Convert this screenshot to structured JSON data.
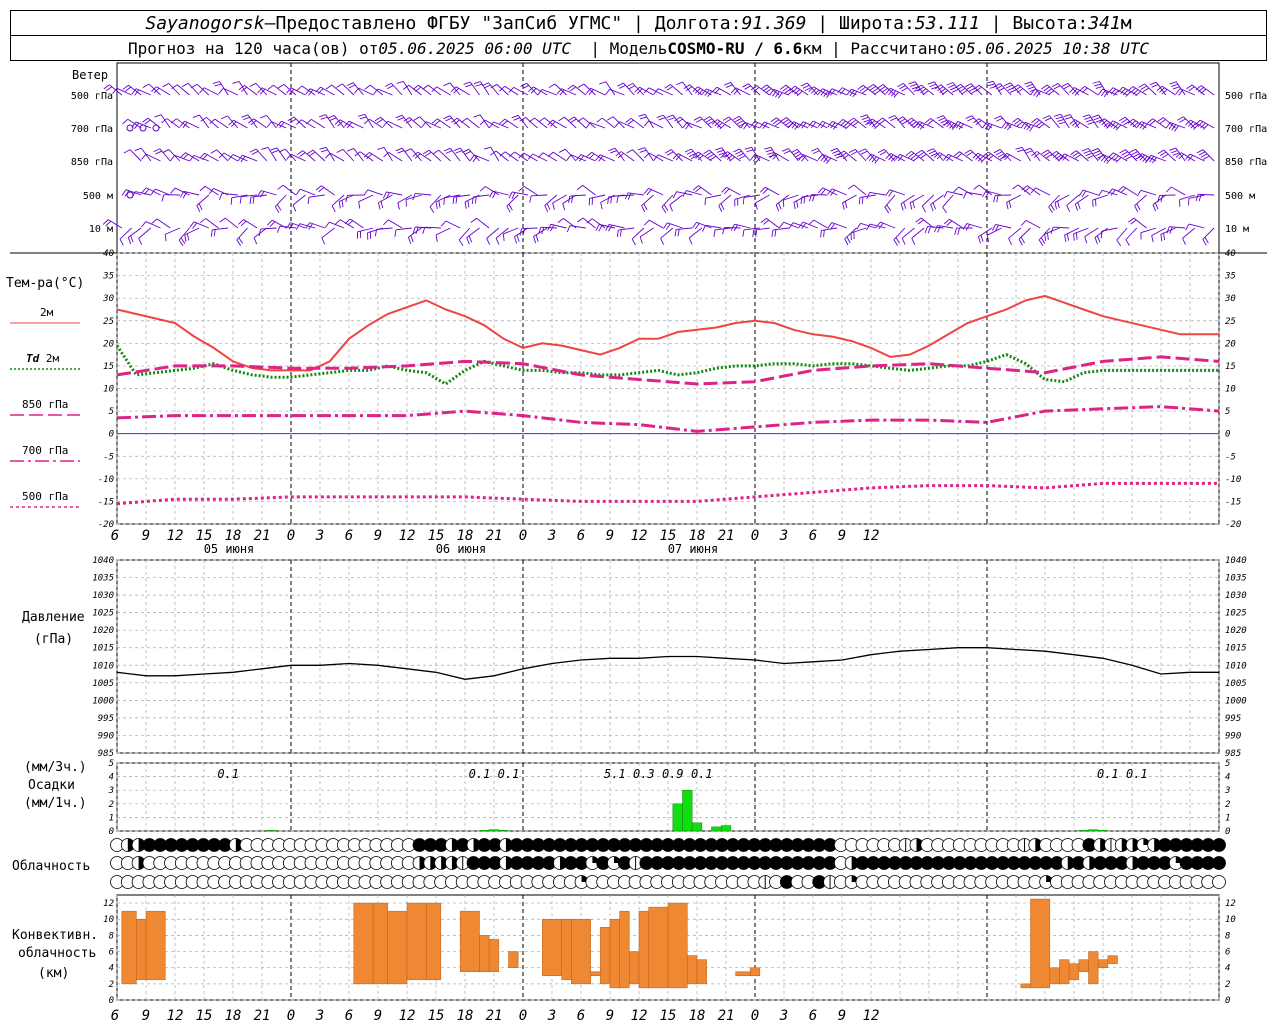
{
  "header": {
    "station": "Sayanogorsk",
    "dash": "—",
    "provided": "Предоставлено ФГБУ \"ЗапСиб УГМС\"",
    "lon_label": "Долгота:",
    "lon": "91.369",
    "lat_label": "Широта:",
    "lat": "53.111",
    "alt_label": "Высота:",
    "alt": "341",
    "alt_unit": "м",
    "forecast_label": "Прогноз на 120 часа(ов) от",
    "forecast_time": "05.06.2025 06:00 UTC",
    "model_label": "Модель",
    "model": "COSMO-RU / 6.6",
    "model_unit": "км",
    "computed_label": "Рассчитано:",
    "computed_time": "05.06.2025 10:38 UTC"
  },
  "colors": {
    "t2m": "#ee4444",
    "td2m": "#118811",
    "t850": "#dd2288",
    "t700": "#dd2288",
    "t500": "#dd2288",
    "zero": "#3333ee",
    "wind": "#6600cc",
    "precip": "#11dd11",
    "convective": "#ee8833",
    "pressure": "#000000",
    "grid": "#aaaaaa"
  },
  "labels": {
    "wind": "Ветер",
    "wind_levels": [
      "500 гПа",
      "700 гПа",
      "850 гПа",
      "500 м",
      "10 м"
    ],
    "temperature": "Тем-ра(°C)",
    "t2m": "2м",
    "td_symbol": "Td",
    "td2m": "2м",
    "t850": "850 гПа",
    "t700": "700 гПа",
    "t500": "500 гПа",
    "pressure": "Давление",
    "pressure_unit": "(гПа)",
    "precip_unit_top": "(мм/3ч.)",
    "precip": "Осадки",
    "precip_unit_bottom": "(мм/1ч.)",
    "clouds": "Облачность",
    "convective_1": "Конвективн.",
    "convective_2": "облачность",
    "convective_3": "(км)"
  },
  "time_axis": {
    "ticks": [
      "6",
      "9",
      "12",
      "15",
      "18",
      "21",
      "0",
      "3",
      "6",
      "9",
      "12",
      "15",
      "18",
      "21",
      "0",
      "3",
      "6",
      "9",
      "12",
      "15",
      "18",
      "21",
      "0",
      "3",
      "6",
      "9",
      "12"
    ],
    "dates": [
      "05 июня",
      "06 июня",
      "07 июня"
    ]
  },
  "chart_data": [
    {
      "type": "line",
      "name": "temperature",
      "x_unit": "hours since 05.06.2025 06:00 UTC",
      "ylim": [
        -20,
        40
      ],
      "yticks": [
        -20,
        -15,
        -10,
        -5,
        0,
        5,
        10,
        15,
        20,
        25,
        30,
        35,
        40
      ],
      "series": [
        {
          "name": "2м",
          "style": "solid",
          "x": [
            0,
            2,
            4,
            6,
            8,
            10,
            12,
            14,
            16,
            18,
            20,
            22,
            24,
            26,
            28,
            30,
            32,
            34,
            36,
            38,
            40,
            42,
            44,
            46,
            48,
            50,
            52,
            54,
            56,
            58,
            60,
            62,
            64,
            66,
            68,
            70,
            72,
            74,
            76,
            78,
            80,
            82,
            84,
            86,
            88,
            90,
            92,
            94,
            96,
            98,
            100,
            102,
            104,
            106,
            108,
            110,
            112,
            114
          ],
          "y": [
            27.5,
            26.5,
            25.5,
            24.5,
            21.5,
            19,
            16,
            14.5,
            14,
            14,
            14,
            16,
            21,
            24,
            26.5,
            28,
            29.5,
            27.5,
            26,
            24,
            21,
            19,
            20,
            19.5,
            18.5,
            17.5,
            19,
            21,
            21,
            22.5,
            23,
            23.5,
            24.5,
            25,
            24.5,
            23,
            22,
            21.5,
            20.5,
            19,
            17,
            17.5,
            19.5,
            22,
            24.5,
            26,
            27.5,
            29.5,
            30.5,
            29,
            27.5,
            26,
            25,
            24,
            23,
            22,
            22,
            22
          ]
        },
        {
          "name": "Td 2м",
          "style": "dotted",
          "x": [
            0,
            2,
            4,
            6,
            8,
            10,
            12,
            14,
            16,
            18,
            20,
            22,
            24,
            26,
            28,
            30,
            32,
            34,
            36,
            38,
            40,
            42,
            44,
            46,
            48,
            50,
            52,
            54,
            56,
            58,
            60,
            62,
            64,
            66,
            68,
            70,
            72,
            74,
            76,
            78,
            80,
            82,
            84,
            86,
            88,
            90,
            92,
            94,
            96,
            98,
            100,
            102,
            104,
            106,
            108,
            110,
            112,
            114
          ],
          "y": [
            19.5,
            13,
            13.5,
            14,
            14.5,
            15.5,
            14,
            13,
            12.5,
            12.5,
            13,
            13.5,
            14,
            14,
            15,
            14,
            13.5,
            11,
            14,
            16,
            15,
            14,
            14,
            13.5,
            13.5,
            13,
            13,
            13.5,
            14,
            13,
            13.5,
            14.5,
            15,
            15,
            15.5,
            15.5,
            15,
            15.5,
            15.5,
            15,
            14.5,
            14,
            14.5,
            15,
            15,
            16,
            17.5,
            15.5,
            12,
            11.5,
            13.5,
            14,
            14,
            14,
            14,
            14,
            14,
            14
          ]
        },
        {
          "name": "850 гПа",
          "style": "longdash",
          "x": [
            0,
            6,
            12,
            18,
            24,
            30,
            36,
            42,
            48,
            54,
            60,
            66,
            72,
            78,
            84,
            90,
            96,
            102,
            108,
            114
          ],
          "y": [
            13,
            15,
            15,
            14.5,
            14.5,
            15,
            16,
            15.5,
            13,
            12,
            11,
            11.5,
            14,
            15,
            15.5,
            14.5,
            13.5,
            16,
            17,
            16
          ]
        },
        {
          "name": "700 гПа",
          "style": "dashdot",
          "x": [
            0,
            6,
            12,
            18,
            24,
            30,
            36,
            42,
            48,
            54,
            60,
            66,
            72,
            78,
            84,
            90,
            96,
            102,
            108,
            114
          ],
          "y": [
            3.5,
            4,
            4,
            4,
            4,
            4,
            5,
            4,
            2.5,
            2,
            0.5,
            1.5,
            2.5,
            3,
            3,
            2.5,
            5,
            5.5,
            6,
            5
          ]
        },
        {
          "name": "500 гПа",
          "style": "shortdash",
          "x": [
            0,
            6,
            12,
            18,
            24,
            30,
            36,
            42,
            48,
            54,
            60,
            66,
            72,
            78,
            84,
            90,
            96,
            102,
            108,
            114
          ],
          "y": [
            -15.5,
            -14.5,
            -14.5,
            -14,
            -14,
            -14,
            -14,
            -14.5,
            -15,
            -15,
            -15,
            -14,
            -13,
            -12,
            -11.5,
            -11.5,
            -12,
            -11,
            -11,
            -11
          ]
        }
      ]
    },
    {
      "type": "line",
      "name": "pressure",
      "x_unit": "hours since 05.06.2025 06:00 UTC",
      "ylim": [
        985,
        1040
      ],
      "yticks": [
        985,
        990,
        995,
        1000,
        1005,
        1010,
        1015,
        1020,
        1025,
        1030,
        1035,
        1040
      ],
      "series": [
        {
          "name": "Давление",
          "style": "solid",
          "x": [
            0,
            3,
            6,
            9,
            12,
            15,
            18,
            21,
            24,
            27,
            30,
            33,
            36,
            39,
            42,
            45,
            48,
            51,
            54,
            57,
            60,
            63,
            66,
            69,
            72,
            75,
            78,
            81,
            84,
            87,
            90,
            93,
            96,
            99,
            102,
            105,
            108,
            111,
            114
          ],
          "y": [
            1008,
            1007,
            1007,
            1007.5,
            1008,
            1009,
            1010,
            1010,
            1010.5,
            1010,
            1009,
            1008,
            1006,
            1007,
            1009,
            1010.5,
            1011.5,
            1012,
            1012,
            1012.5,
            1012.5,
            1012,
            1011.5,
            1010.5,
            1011,
            1011.5,
            1013,
            1014,
            1014.5,
            1015,
            1015,
            1014.5,
            1014,
            1013,
            1012,
            1010,
            1007.5,
            1008,
            1008
          ]
        }
      ]
    },
    {
      "type": "bar",
      "name": "precipitation",
      "x_unit": "hours since 05.06.2025 06:00 UTC",
      "ylim": [
        0,
        5
      ],
      "yticks": [
        0,
        1,
        2,
        3,
        4,
        5
      ],
      "values_x": [
        16,
        17,
        18,
        36,
        37,
        38,
        39,
        40,
        41,
        42,
        52,
        53,
        54,
        55,
        56,
        57,
        58,
        59,
        60,
        61,
        62,
        63,
        100,
        101,
        102
      ],
      "values": [
        0.05,
        0,
        0,
        0,
        0,
        0.05,
        0.1,
        0.05,
        0,
        0,
        0,
        0,
        0,
        0,
        0,
        0,
        2,
        3,
        0.6,
        0,
        0.3,
        0.4,
        0.05,
        0.1,
        0.05
      ],
      "totals": [
        {
          "x": 11.5,
          "label": "0.1"
        },
        {
          "x": 37.5,
          "label": "0.1"
        },
        {
          "x": 40.5,
          "label": "0.1"
        },
        {
          "x": 51.5,
          "label": "5.1"
        },
        {
          "x": 54.5,
          "label": "0.3"
        },
        {
          "x": 57.5,
          "label": "0.9"
        },
        {
          "x": 60.5,
          "label": "0.1"
        },
        {
          "x": 102.5,
          "label": "0.1"
        },
        {
          "x": 105.5,
          "label": "0.1"
        }
      ]
    },
    {
      "type": "bar",
      "name": "convective_cloud",
      "x_unit": "hours since 05.06.2025 06:00 UTC",
      "ylim": [
        0,
        13
      ],
      "yticks": [
        0,
        2,
        4,
        6,
        8,
        10,
        12
      ],
      "bars": [
        {
          "x0": 0.5,
          "x1": 2,
          "lo": 2,
          "hi": 11
        },
        {
          "x0": 2,
          "x1": 3,
          "lo": 2.5,
          "hi": 10
        },
        {
          "x0": 3,
          "x1": 5,
          "lo": 2.5,
          "hi": 11
        },
        {
          "x0": 24.5,
          "x1": 26.5,
          "lo": 2,
          "hi": 12
        },
        {
          "x0": 26.5,
          "x1": 28,
          "lo": 2,
          "hi": 12
        },
        {
          "x0": 28,
          "x1": 30,
          "lo": 2,
          "hi": 11
        },
        {
          "x0": 30,
          "x1": 32,
          "lo": 2.5,
          "hi": 12
        },
        {
          "x0": 32,
          "x1": 33.5,
          "lo": 2.5,
          "hi": 12
        },
        {
          "x0": 35.5,
          "x1": 37.5,
          "lo": 3.5,
          "hi": 11
        },
        {
          "x0": 37.5,
          "x1": 38.5,
          "lo": 3.5,
          "hi": 8
        },
        {
          "x0": 38.5,
          "x1": 39.5,
          "lo": 3.5,
          "hi": 7.5
        },
        {
          "x0": 40.5,
          "x1": 41.5,
          "lo": 4,
          "hi": 6
        },
        {
          "x0": 44,
          "x1": 46,
          "lo": 3,
          "hi": 10
        },
        {
          "x0": 46,
          "x1": 47,
          "lo": 2.5,
          "hi": 10
        },
        {
          "x0": 47,
          "x1": 49,
          "lo": 2,
          "hi": 10
        },
        {
          "x0": 49,
          "x1": 50,
          "lo": 3,
          "hi": 3.5
        },
        {
          "x0": 50,
          "x1": 51,
          "lo": 2,
          "hi": 9
        },
        {
          "x0": 51,
          "x1": 52,
          "lo": 1.5,
          "hi": 10
        },
        {
          "x0": 52,
          "x1": 53,
          "lo": 1.5,
          "hi": 11
        },
        {
          "x0": 53,
          "x1": 54,
          "lo": 2,
          "hi": 6
        },
        {
          "x0": 54,
          "x1": 55,
          "lo": 1.5,
          "hi": 11
        },
        {
          "x0": 55,
          "x1": 57,
          "lo": 1.5,
          "hi": 11.5
        },
        {
          "x0": 57,
          "x1": 59,
          "lo": 1.5,
          "hi": 12
        },
        {
          "x0": 59,
          "x1": 60,
          "lo": 2,
          "hi": 5.5
        },
        {
          "x0": 60,
          "x1": 61,
          "lo": 2,
          "hi": 5
        },
        {
          "x0": 64,
          "x1": 65.5,
          "lo": 3,
          "hi": 3.5
        },
        {
          "x0": 65.5,
          "x1": 66.5,
          "lo": 3,
          "hi": 4
        },
        {
          "x0": 93.5,
          "x1": 94.5,
          "lo": 1.5,
          "hi": 2
        },
        {
          "x0": 94.5,
          "x1": 96.5,
          "lo": 1.5,
          "hi": 12.5
        },
        {
          "x0": 96.5,
          "x1": 97.5,
          "lo": 2,
          "hi": 4
        },
        {
          "x0": 97.5,
          "x1": 98.5,
          "lo": 2,
          "hi": 5
        },
        {
          "x0": 98.5,
          "x1": 99.5,
          "lo": 2.5,
          "hi": 4.5
        },
        {
          "x0": 99.5,
          "x1": 100.5,
          "lo": 3.5,
          "hi": 5
        },
        {
          "x0": 100.5,
          "x1": 101.5,
          "lo": 2,
          "hi": 6
        },
        {
          "x0": 101.5,
          "x1": 102.5,
          "lo": 4,
          "hi": 5
        },
        {
          "x0": 102.5,
          "x1": 103.5,
          "lo": 4.5,
          "hi": 5.5
        }
      ]
    },
    {
      "type": "table",
      "name": "cloud_cover",
      "rows": [
        "0336444444430000000000000000555343443444444444444444444444444444444000000130000000001300004313323444444",
        "0030000000000000000000000000333314443444434424241444444444444444444034444444444444444444343444344424444",
        "0000000000000000000000000000000000000000000200000000000000001040041020000000000000000020000000000000000"
      ]
    }
  ]
}
